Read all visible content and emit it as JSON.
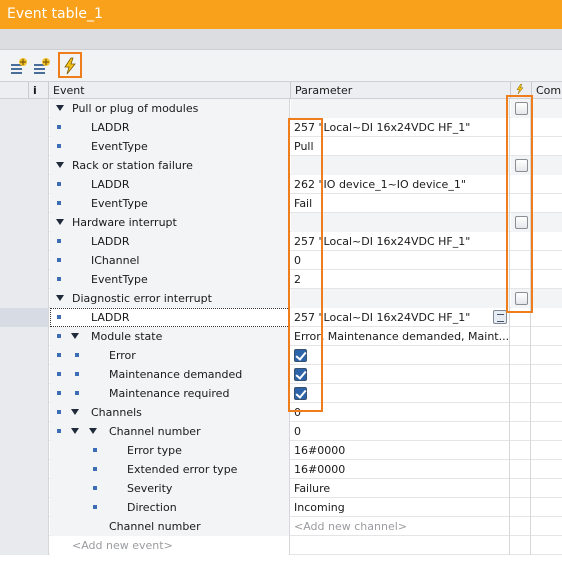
{
  "window": {
    "title": "Event table_1"
  },
  "toolbar": {
    "buttons": [
      {
        "name": "add-row-icon"
      },
      {
        "name": "add-rows-icon"
      },
      {
        "name": "lightning-icon",
        "highlighted": true
      }
    ]
  },
  "columns": {
    "info": "i",
    "event": "Event",
    "parameter": "Parameter",
    "flag_icon": "lightning-icon",
    "comment": "Comm"
  },
  "rows": [
    {
      "label": "Pull or plug of modules",
      "param": ""
    },
    {
      "label": "LADDR",
      "param": "257 \"Local~DI 16x24VDC HF_1\""
    },
    {
      "label": "EventType",
      "param": "Pull"
    },
    {
      "label": "Rack or station failure",
      "param": ""
    },
    {
      "label": "LADDR",
      "param": "262 \"IO device_1~IO device_1\""
    },
    {
      "label": "EventType",
      "param": "Fail"
    },
    {
      "label": "Hardware interrupt",
      "param": ""
    },
    {
      "label": "LADDR",
      "param": "257 \"Local~DI 16x24VDC HF_1\""
    },
    {
      "label": "IChannel",
      "param": "0"
    },
    {
      "label": "EventType",
      "param": "2"
    },
    {
      "label": "Diagnostic error interrupt",
      "param": ""
    },
    {
      "label": "LADDR",
      "param": "257 \"Local~DI 16x24VDC HF_1\""
    },
    {
      "label": "Module state",
      "param": "Error, Maintenance demanded, Maint..."
    },
    {
      "label": "Error",
      "param": ""
    },
    {
      "label": "Maintenance demanded",
      "param": ""
    },
    {
      "label": "Maintenance required",
      "param": ""
    },
    {
      "label": "Channels",
      "param": "0"
    },
    {
      "label": "Channel number",
      "param": "0"
    },
    {
      "label": "Error type",
      "param": "16#0000"
    },
    {
      "label": "Extended error type",
      "param": "16#0000"
    },
    {
      "label": "Severity",
      "param": "Failure"
    },
    {
      "label": "Direction",
      "param": "Incoming"
    },
    {
      "label": "Channel number",
      "param": "<Add new channel>"
    },
    {
      "label": "<Add new event>",
      "param": ""
    }
  ],
  "checks": {
    "error": true,
    "maintenance_demanded": true,
    "maintenance_required": true
  },
  "event_flags": [
    false,
    false,
    false,
    false
  ],
  "colors": {
    "title_bar": "#f9a11b",
    "highlight": "#f07d1c",
    "bullet": "#3d6db6",
    "checkbox": "#2d63a8"
  }
}
